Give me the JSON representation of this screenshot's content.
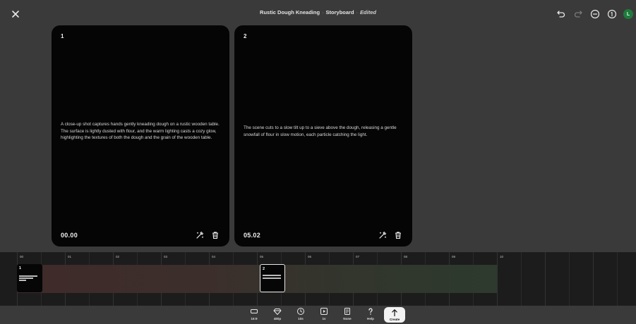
{
  "header": {
    "project": "Rustic Dough Kneading",
    "separator": "·",
    "view": "Storyboard",
    "status": "Edited",
    "avatar_initial": "L",
    "icons": [
      "undo-icon",
      "redo-icon",
      "minus-circle-icon",
      "info-circle-icon",
      "avatar"
    ]
  },
  "cards": [
    {
      "number": "1",
      "text": "A close-up shot captures hands gently kneading dough on a rustic wooden table. The surface is lightly dusted with flour, and the warm lighting casts a cozy glow, highlighting the textures of both the dough and the grain of the wooden table.",
      "time": "00.00"
    },
    {
      "number": "2",
      "text": "The scene cuts to a slow tilt up to a sieve above the dough, releasing a gentle snowfall of flour in slow motion, each particle catching the light.",
      "time": "05.02"
    }
  ],
  "timeline": {
    "ticks": [
      "00",
      "01",
      "02",
      "03",
      "04",
      "05",
      "06",
      "07",
      "08",
      "09",
      "10"
    ],
    "clips": [
      {
        "number": "1",
        "selected": false
      },
      {
        "number": "2",
        "selected": true
      }
    ]
  },
  "toolbar": {
    "items": [
      {
        "label": "16:9",
        "icon": "aspect-ratio-icon"
      },
      {
        "label": "480p",
        "icon": "diamond-icon"
      },
      {
        "label": "10s",
        "icon": "clock-icon"
      },
      {
        "label": "1v",
        "icon": "play-square-icon"
      },
      {
        "label": "None",
        "icon": "document-icon"
      },
      {
        "label": "Help",
        "icon": "question-icon"
      }
    ],
    "create_label": "Create"
  },
  "colors": {
    "background": "#3a3a3a",
    "card": "#050505",
    "timeline": "#1c1c1c",
    "avatar": "#1f7a3c"
  }
}
